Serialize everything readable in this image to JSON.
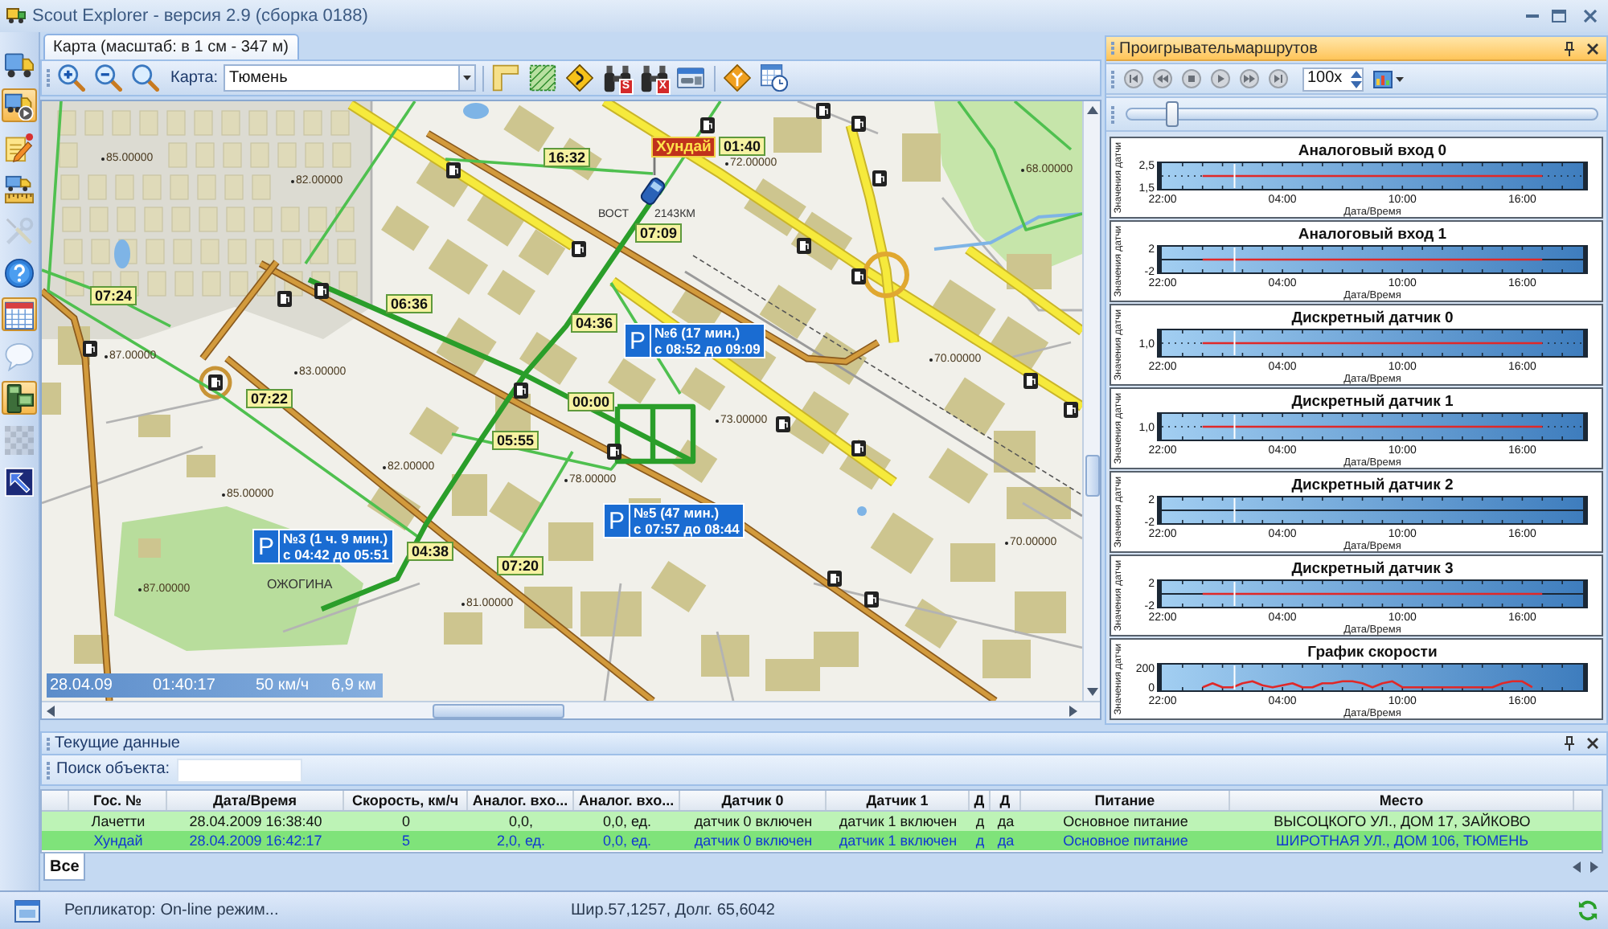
{
  "window": {
    "title": "Scout Explorer - версия 2.9 (сборка 0188)"
  },
  "sidebar": {
    "items": [
      {
        "active": false,
        "disabled": false
      },
      {
        "active": true,
        "disabled": false
      },
      {
        "active": false,
        "disabled": false
      },
      {
        "active": false,
        "disabled": false
      },
      {
        "active": false,
        "disabled": true
      },
      {
        "active": false,
        "disabled": false
      },
      {
        "active": true,
        "disabled": false
      },
      {
        "active": false,
        "disabled": false
      },
      {
        "active": true,
        "disabled": false
      },
      {
        "active": false,
        "disabled": true
      },
      {
        "active": false,
        "disabled": false
      }
    ]
  },
  "map_panel": {
    "tabs": [
      {
        "label": "Карта (масштаб: в 1 см - 347 м)",
        "selected": true
      }
    ],
    "toolbar": {
      "map_label": "Карта:",
      "map_value": "Тюмень",
      "binocular_badges": [
        "S",
        "X"
      ]
    },
    "map": {
      "vehicle": {
        "name": "Хундай"
      },
      "time_marks": [
        "16:32",
        "01:40",
        "07:09",
        "07:24",
        "06:36",
        "04:36",
        "07:22",
        "00:00",
        "05:55",
        "04:38",
        "07:20"
      ],
      "parkings": [
        {
          "sign": "P",
          "title": "№6 (17 мин.)",
          "period": "с 08:52 до 09:09"
        },
        {
          "sign": "P",
          "title": "№5 (47 мин.)",
          "period": "с 07:57 до 08:44"
        },
        {
          "sign": "P",
          "title": "№3 (1 ч. 9 мин.)",
          "period": "с 04:42 до 05:51"
        }
      ],
      "heights": [
        "85.00000",
        "82.00000",
        "72.00000",
        "68.00000",
        "87.00000",
        "83.00000",
        "70.00000",
        "73.00000",
        "82.00000",
        "85.00000",
        "78.00000",
        "70.00000",
        "87.00000",
        "81.00000"
      ],
      "places": [
        "ОЖОГИНА",
        "ВОСТ",
        "2143КМ"
      ],
      "status": {
        "date": "28.04.09",
        "time": "01:40:17",
        "speed": "50 км/ч",
        "distance": "6,9 км"
      }
    }
  },
  "route_player": {
    "title": "Проигрывательмаршрутов",
    "speed": "100x",
    "position": {
      "level": 0.1
    },
    "charts": [
      {
        "chart_data": {
          "type": "line",
          "title": "Аналоговый вход 0",
          "xlabel": "Дата/Время",
          "ylabel": "Значения датчи",
          "categories": [
            "22:00",
            null,
            null,
            null,
            null,
            null,
            "04:00",
            null,
            null,
            null,
            null,
            null,
            "10:00",
            null,
            null,
            null,
            null,
            null,
            "16:00",
            null,
            null,
            null
          ],
          "series": [
            {
              "color": "#e02828",
              "values": [
                null,
                null,
                2,
                2,
                2,
                2,
                2,
                2,
                2,
                2,
                2,
                2,
                2,
                2,
                2,
                2,
                2,
                2,
                2,
                2,
                null,
                null
              ]
            }
          ],
          "ylim": [
            1.4,
            2.6
          ],
          "yticks": [
            {
              "value": 2.5,
              "label": "2,5"
            },
            {
              "value": 1.5,
              "label": "1,5"
            }
          ],
          "ref_lines": [
            {
              "axis": "y",
              "value": 2,
              "color": "#1b2836"
            }
          ]
        }
      },
      {
        "chart_data": {
          "type": "line",
          "title": "Аналоговый вход 1",
          "xlabel": "Дата/Время",
          "ylabel": "Значения датчи",
          "categories": [
            "22:00",
            null,
            null,
            null,
            null,
            null,
            "04:00",
            null,
            null,
            null,
            null,
            null,
            "10:00",
            null,
            null,
            null,
            null,
            null,
            "16:00",
            null,
            null,
            null
          ],
          "series": [
            {
              "color": "#e02828",
              "values": [
                null,
                null,
                0,
                0,
                0,
                0,
                0,
                0,
                0,
                0,
                0,
                0,
                0,
                0,
                0,
                0,
                0,
                0,
                0,
                0,
                null,
                null
              ]
            }
          ],
          "ylim": [
            -2.4,
            2.4
          ],
          "yticks": [
            {
              "value": 2,
              "label": "2"
            },
            {
              "value": -2,
              "label": "-2"
            }
          ]
        }
      },
      {
        "picture": {
          "title": "Дискретный датчик 0",
          "xlabel": "Дата/Время",
          "ylabel": "Значения датчи",
          "ytick": "1,0",
          "xticks": [
            "22:00",
            "04:00",
            "10:00",
            "16:00"
          ]
        }
      },
      {
        "picture": {
          "title": "Дискретный датчик 1",
          "xlabel": "Дата/Время",
          "ylabel": "Значения датчи",
          "ytick": "1,0",
          "xticks": [
            "22:00",
            "04:00",
            "10:00",
            "16:00"
          ]
        }
      },
      {
        "chart_data": {
          "type": "line",
          "title": "Дискретный датчик 2",
          "xlabel": "Дата/Время",
          "ylabel": "Значения датчи",
          "categories": [
            "22:00",
            null,
            null,
            null,
            null,
            null,
            "04:00",
            null,
            null,
            null,
            null,
            null,
            "10:00",
            null,
            null,
            null,
            null,
            null,
            "16:00",
            null,
            null,
            null
          ],
          "ylim": [
            -2.4,
            2.4
          ],
          "yticks": [
            {
              "value": 2,
              "label": "2"
            },
            {
              "value": -2,
              "label": "-2"
            }
          ]
        }
      },
      {
        "chart_data": {
          "type": "line",
          "title": "Дискретный датчик 3",
          "xlabel": "Дата/Время",
          "ylabel": "Значения датчи",
          "categories": [
            "22:00",
            null,
            null,
            null,
            null,
            null,
            "04:00",
            null,
            null,
            null,
            null,
            null,
            "10:00",
            null,
            null,
            null,
            null,
            null,
            "16:00",
            null,
            null,
            null
          ],
          "series": [
            {
              "color": "#e02828",
              "values": [
                null,
                null,
                0,
                0,
                0,
                0,
                0,
                0,
                0,
                0,
                0,
                0,
                0,
                0,
                0,
                0,
                0,
                0,
                0,
                0,
                null,
                null
              ]
            }
          ],
          "ylim": [
            -2.4,
            2.4
          ],
          "yticks": [
            {
              "value": 2,
              "label": "2"
            },
            {
              "value": -2,
              "label": "-2"
            }
          ]
        }
      },
      {
        "chart_data": {
          "type": "line",
          "title": "График скорости",
          "xlabel": "Дата/Время",
          "ylabel": "Значения датчи",
          "categories": [
            "22:00",
            null,
            null,
            null,
            null,
            null,
            null,
            null,
            null,
            null,
            null,
            null,
            "04:00",
            null,
            null,
            null,
            null,
            null,
            null,
            null,
            null,
            null,
            null,
            null,
            "10:00",
            null,
            null,
            null,
            null,
            null,
            null,
            null,
            null,
            null,
            null,
            null,
            "16:00",
            null,
            null,
            null,
            null,
            null,
            null
          ],
          "series": [
            {
              "color": "#e02828",
              "values": [
                null,
                null,
                null,
                null,
                0,
                40,
                0,
                0,
                40,
                60,
                20,
                0,
                20,
                40,
                0,
                0,
                40,
                40,
                60,
                60,
                40,
                0,
                40,
                60,
                0,
                0,
                0,
                0,
                0,
                0,
                0,
                0,
                0,
                0,
                40,
                60,
                60,
                0,
                null,
                null,
                null,
                null,
                null
              ]
            }
          ],
          "ylim": [
            -40,
            240
          ],
          "yticks": [
            {
              "value": 200,
              "label": "200"
            },
            {
              "value": 0,
              "label": "0"
            }
          ]
        }
      }
    ]
  },
  "current_data": {
    "title": "Текущие данные",
    "search_label": "Поиск объекта:",
    "table": {
      "columns": [
        "Гос. №",
        "Дата/Время",
        "Скорость, км/ч",
        "Аналог. вхо...",
        "Аналог. вхо...",
        "Датчик 0",
        "Датчик 1",
        "Д",
        "Д",
        "Питание",
        "Место"
      ],
      "rows": [
        {
          "selected": false,
          "cells": [
            "Лачетти",
            "28.04.2009 16:38:40",
            "0",
            "0,0,",
            "0,0, ед.",
            "датчик 0 включен",
            "датчик 1 включен",
            "д",
            "да",
            "Основное питание",
            "ВЫСОЦКОГО УЛ., ДОМ 17, ЗАЙКОВО"
          ]
        },
        {
          "selected": true,
          "cells": [
            "Хундай",
            "28.04.2009 16:42:17",
            "5",
            "2,0, ед.",
            "0,0, ед.",
            "датчик 0 включен",
            "датчик 1 включен",
            "д",
            "да",
            "Основное питание",
            "ШИРОТНАЯ УЛ., ДОМ 106, ТЮМЕНЬ"
          ]
        }
      ]
    },
    "tabs": [
      {
        "label": "Все",
        "selected": true
      }
    ]
  },
  "status_bar": {
    "message": "Репликатор: On-line режим...",
    "coordinates": "Шир.57,1257, Долг. 65,6042"
  }
}
